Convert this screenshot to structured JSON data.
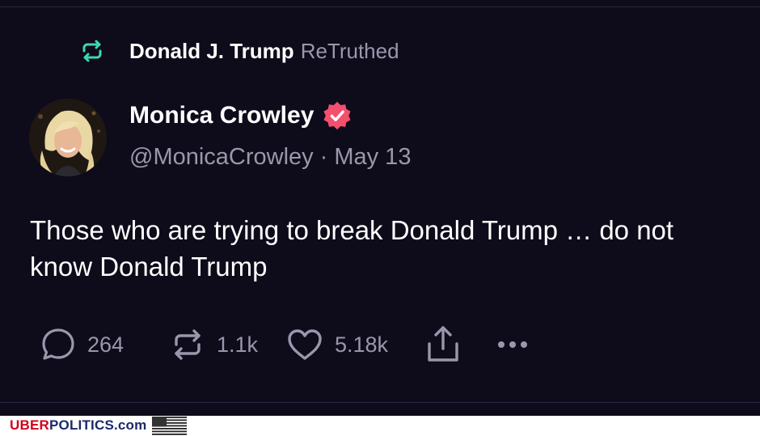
{
  "retruth": {
    "name": "Donald J. Trump",
    "action": "ReTruthed",
    "icon": "retruth-icon",
    "icon_color": "#3ed6b2"
  },
  "author": {
    "name": "Monica Crowley",
    "handle": "@MonicaCrowley",
    "separator": "·",
    "date": "May 13",
    "verified_icon": "verified-badge-icon",
    "badge_color": "#f4506e"
  },
  "post": {
    "text": "Those who are trying to break Donald Trump … do not know Donald Trump"
  },
  "actions": {
    "replies": "264",
    "retruths": "1.1k",
    "likes": "5.18k",
    "share_icon": "share-icon",
    "more_icon": "more-icon"
  },
  "footer": {
    "brand_part1": "UBER",
    "brand_part2": "POLITICS.com",
    "flag_icon": "us-flag-icon"
  },
  "colors": {
    "background": "#0e0b1a",
    "text_primary": "#ffffff",
    "text_secondary": "#9a97ad"
  }
}
